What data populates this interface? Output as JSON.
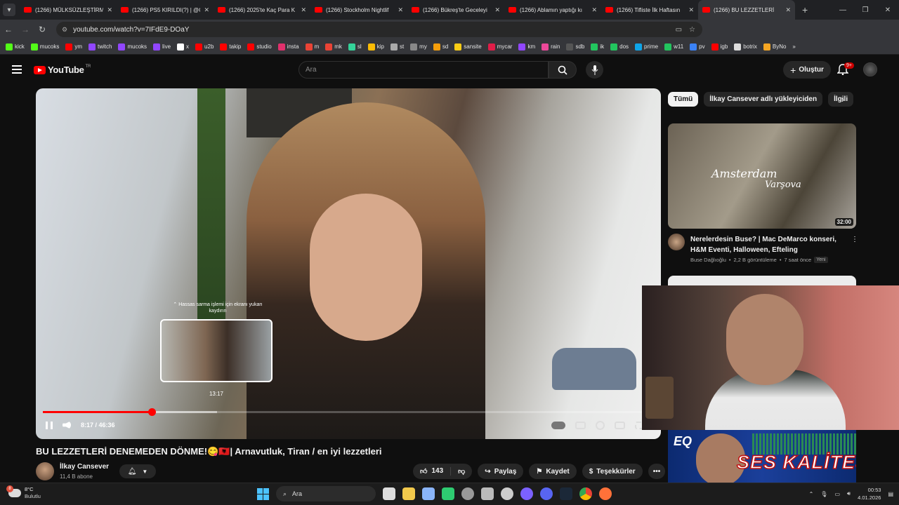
{
  "browser": {
    "tabs": [
      {
        "title": "(1266) MÜLKSÜZLEŞTİRM",
        "active": false
      },
      {
        "title": "(1266) PS5 KIRILDI(?) | @C",
        "active": false
      },
      {
        "title": "(1266) 2025'te Kaç Para K",
        "active": false
      },
      {
        "title": "(1266) Stockholm Nightlif",
        "active": false
      },
      {
        "title": "(1266) Bükreş'te Geceleyi",
        "active": false
      },
      {
        "title": "(1266) Ablamın yaptığı kı",
        "active": false
      },
      {
        "title": "(1266) Tifliste İlk Haftasın",
        "active": false
      },
      {
        "title": "(1266) BU LEZZETLERİ",
        "active": true
      }
    ],
    "url": "youtube.com/watch?v=7IFdE9-DOaY",
    "bookmarks": [
      "kick",
      "mucoks",
      "ym",
      "twitch",
      "mucoks",
      "live",
      "x",
      "u2b",
      "takip",
      "studio",
      "insta",
      "m",
      "mk",
      "sl",
      "kip",
      "st",
      "my",
      "sd",
      "sansite",
      "mycar",
      "km",
      "rain",
      "sdb",
      "ik",
      "dos",
      "prime",
      "w11",
      "pv",
      "igb",
      "botrix",
      "ByNo"
    ]
  },
  "youtube": {
    "logo_text": "YouTube",
    "logo_sup": "TR",
    "search_placeholder": "Ara",
    "create_label": "Oluştur",
    "notif_count": "9+"
  },
  "player": {
    "scrub_hint": "Hassas sarma işlemi için ekranı yukarı kaydırın",
    "preview_time": "13:17",
    "current_time": "8:17",
    "duration": "46:36",
    "time_display": "8:17 / 46:36",
    "progress_fraction": 0.178,
    "buffer_fraction": 0.285
  },
  "video": {
    "title": "BU LEZZETLERİ DENEMEDEN DÖNME!😋🇦🇱| Arnavutluk, Tiran / en iyi lezzetleri",
    "channel": "İlkay Cansever",
    "subscribers": "11,4 B abone",
    "likes": "143",
    "share_label": "Paylaş",
    "save_label": "Kaydet",
    "thanks_label": "Teşekkürler"
  },
  "sidebar": {
    "chips": [
      "Tümü",
      "İlkay Cansever adlı yükleyiciden",
      "İlgili"
    ],
    "recommendations": [
      {
        "title": "Nerelerdesin Buse? | Mac DeMarco konseri, H&M Eventi, Halloween, Efteling",
        "channel": "Buse Dağlıoğlu",
        "views": "2,2 B görüntüleme",
        "age": "7 saat önce",
        "badge": "Yeni",
        "duration": "32:00",
        "thumb_text_1": "Amsterdam",
        "thumb_text_2": "Varşova"
      }
    ]
  },
  "stream_overlay": {
    "tag": "EQ",
    "banner_text": "SES KALİTESİNİ"
  },
  "taskbar": {
    "temperature": "8°C",
    "weather": "Bulutlu",
    "search_label": "Ara",
    "time": "00:53",
    "date": "4.01.2026"
  }
}
